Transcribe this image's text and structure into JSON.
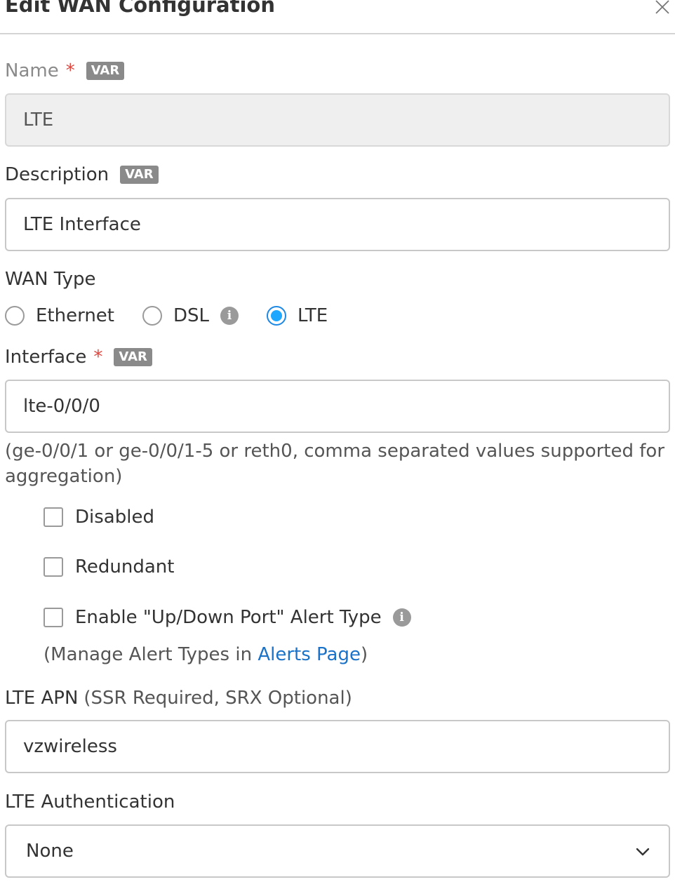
{
  "dialog": {
    "title": "Edit WAN Configuration"
  },
  "name": {
    "label": "Name",
    "required": "*",
    "badge": "VAR",
    "value": "LTE"
  },
  "description": {
    "label": "Description",
    "badge": "VAR",
    "value": "LTE Interface"
  },
  "wan_type": {
    "label": "WAN Type",
    "options": [
      "Ethernet",
      "DSL",
      "LTE"
    ],
    "selected": "LTE"
  },
  "interface": {
    "label": "Interface",
    "required": "*",
    "badge": "VAR",
    "value": "lte-0/0/0",
    "hint": "(ge-0/0/1 or ge-0/0/1-5 or reth0, comma separated values supported for aggregation)"
  },
  "checkboxes": {
    "disabled": "Disabled",
    "redundant": "Redundant",
    "alert": "Enable \"Up/Down Port\" Alert Type"
  },
  "manage": {
    "prefix": "(Manage Alert Types in ",
    "link": "Alerts Page",
    "suffix": ")"
  },
  "lte_apn": {
    "label": "LTE APN",
    "note": "(SSR Required, SRX Optional)",
    "value": "vzwireless"
  },
  "lte_auth": {
    "label": "LTE Authentication",
    "value": "None"
  },
  "icons": {
    "close": "close-icon",
    "info": "info-icon",
    "chevron": "chevron-down-icon"
  },
  "colors": {
    "accent": "#1ea7ff",
    "link": "#1a73c8",
    "required": "#e0463e",
    "badge": "#8a8a8a"
  }
}
